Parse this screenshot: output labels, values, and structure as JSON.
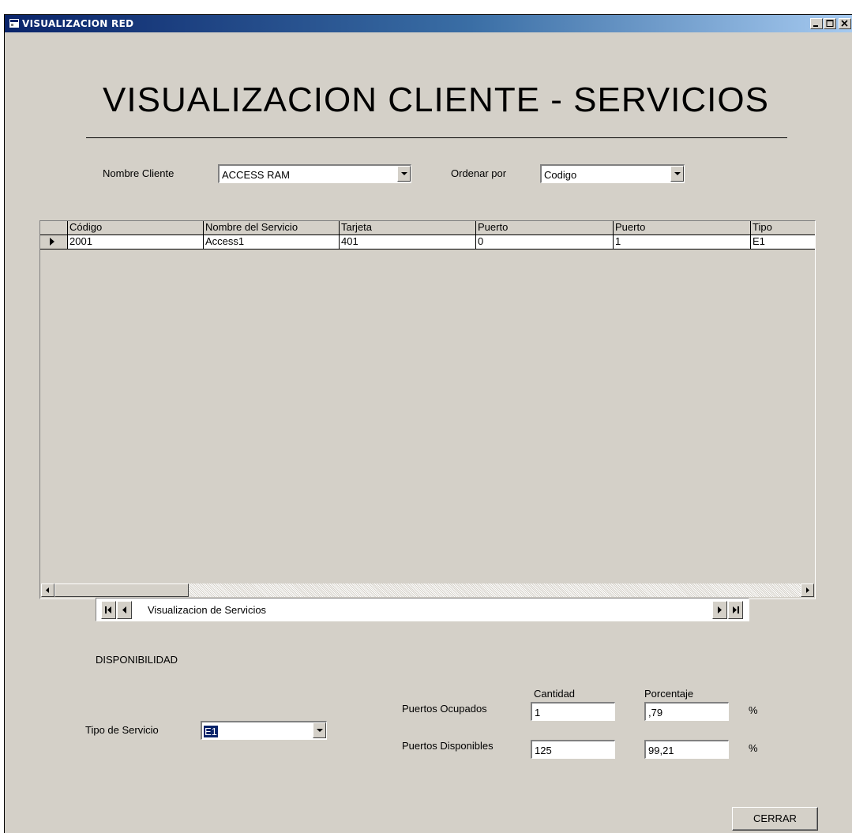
{
  "window": {
    "title": "VISUALIZACION RED",
    "icon": "app-window-icon",
    "controls": [
      "minimize-icon",
      "maximize-icon",
      "close-icon"
    ]
  },
  "heading": "VISUALIZACION CLIENTE - SERVICIOS",
  "filters": {
    "client_label": "Nombre Cliente",
    "client_value": "ACCESS RAM",
    "order_label": "Ordenar por",
    "order_value": "Codigo"
  },
  "grid": {
    "columns": [
      "Código",
      "Nombre del Servicio",
      "Tarjeta",
      "Puerto",
      "Puerto",
      "Tipo"
    ],
    "rows": [
      [
        "2001",
        "Access1",
        "401",
        "0",
        "1",
        "E1"
      ]
    ]
  },
  "navigator": {
    "caption": "Visualizacion de Servicios"
  },
  "availability": {
    "section_label": "DISPONIBILIDAD",
    "service_type_label": "Tipo de Servicio",
    "service_type_value": "E1",
    "quantity_header": "Cantidad",
    "percent_header": "Porcentaje",
    "occupied_label": "Puertos Ocupados",
    "occupied_qty": "1",
    "occupied_pct": ",79",
    "available_label": "Puertos Disponibles",
    "available_qty": "125",
    "available_pct": "99,21",
    "percent_sign": "%"
  },
  "actions": {
    "close_label": "CERRAR"
  },
  "colors": {
    "titlebar_start": "#0a246a",
    "titlebar_end": "#a6caf0",
    "face": "#d4d0c8",
    "selection": "#0a246a"
  }
}
